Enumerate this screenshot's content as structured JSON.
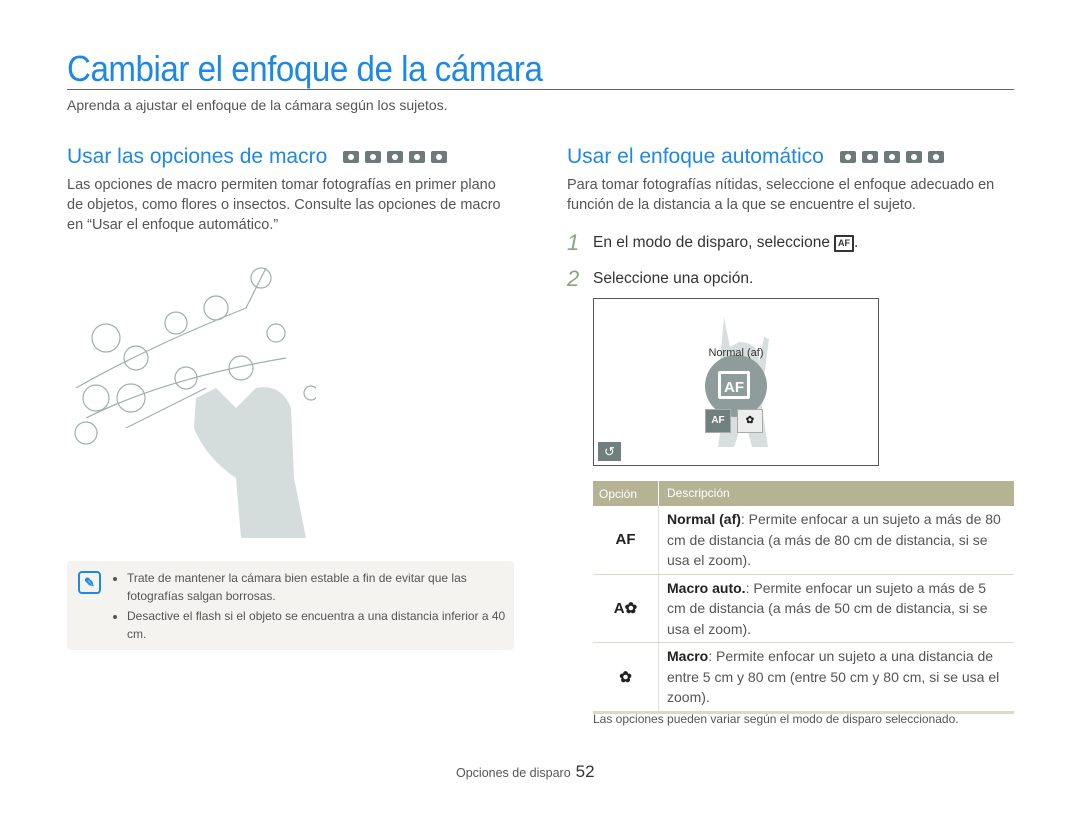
{
  "page": {
    "title": "Cambiar el enfoque de la cámara",
    "subtitle": "Aprenda a ajustar el enfoque de la cámara según los sujetos."
  },
  "macro_section": {
    "heading": "Usar las opciones de macro",
    "mode_icons": [
      "camera-smart-auto-icon",
      "camera-program-icon",
      "dual-is-icon",
      "smart-movie-icon",
      "movie-icon"
    ],
    "body": "Las opciones de macro permiten tomar fotografías en primer plano de objetos, como flores o insectos. Consulte las opciones de macro en “Usar el enfoque automático.”",
    "illustration": "woman-photographing-magnolia-branch"
  },
  "note": {
    "icon": "note-pencil-icon",
    "items": [
      "Trate de mantener la cámara bien estable a fin de evitar que las fotografías salgan borrosas.",
      "Desactive el flash si el objeto se encuentra a una distancia inferior a 40 cm."
    ]
  },
  "autofocus_section": {
    "heading": "Usar el enfoque automático",
    "mode_icons": [
      "camera-smart-auto-icon",
      "camera-program-icon",
      "dual-is-icon",
      "smart-movie-icon",
      "movie-icon"
    ],
    "body": "Para tomar fotografías nítidas, seleccione el enfoque adecuado en función de la distancia a la que se encuentre el sujeto.",
    "steps": [
      {
        "num": "1",
        "text": "En el modo de disparo, seleccione",
        "icon_label": "AF",
        "suffix": "."
      },
      {
        "num": "2",
        "text": "Seleccione una opción."
      }
    ],
    "screen": {
      "focus_label": "Normal (af)",
      "focus_icon": "AF",
      "options": [
        {
          "icon": "af-normal-icon",
          "label": "AF",
          "selected": true
        },
        {
          "icon": "macro-flower-icon",
          "label": "✿",
          "selected": false
        }
      ],
      "back_icon": "↺"
    },
    "table": {
      "headers": [
        "Opción",
        "Descripción"
      ],
      "rows": [
        {
          "icon": "af-normal-icon",
          "glyph": "AF",
          "name": "Normal (af)",
          "desc": ": Permite enfocar a un sujeto a más de 80 cm de distancia (a más de 80 cm de distancia, si se usa el zoom)."
        },
        {
          "icon": "auto-macro-icon",
          "glyph": "A✿",
          "name": "Macro auto.",
          "desc": ": Permite enfocar un sujeto a más de 5 cm de distancia (a más de 50 cm de distancia, si se usa el zoom)."
        },
        {
          "icon": "macro-icon",
          "glyph": "✿",
          "name": "Macro",
          "desc": ": Permite enfocar un sujeto a una distancia de entre 5 cm y 80 cm (entre 50 cm y 80 cm, si se usa el zoom)."
        }
      ],
      "note": "Las opciones pueden variar según el modo de disparo seleccionado."
    }
  },
  "footer": {
    "section": "Opciones de disparo",
    "page_number": "52"
  },
  "colors": {
    "accent": "#1e88e5",
    "table_header": "#b5b393",
    "icon_gray": "#6f807e"
  }
}
